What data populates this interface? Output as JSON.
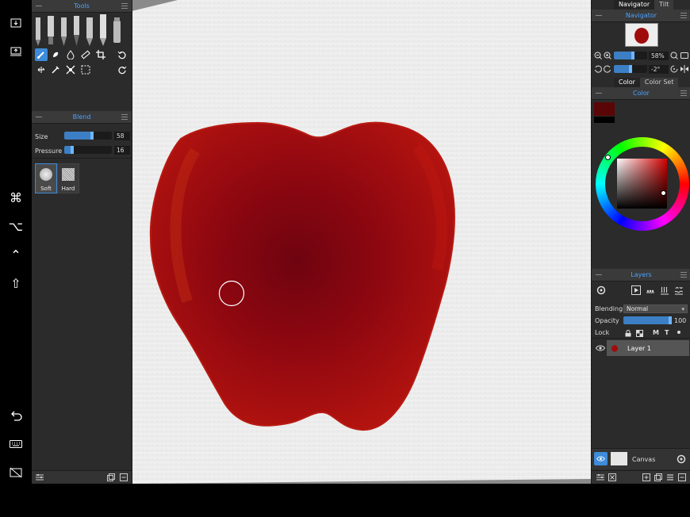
{
  "system_bar": {
    "icons": [
      "import-icon",
      "export-icon",
      "command-key-icon",
      "option-key-icon",
      "control-key-icon",
      "shift-key-icon",
      "undo-gesture-icon",
      "keyboard-icon",
      "hide-ui-icon"
    ]
  },
  "tools_panel": {
    "title": "Tools",
    "brushes": [
      "pencil",
      "brush-flat",
      "brush-round",
      "pen",
      "marker",
      "airbrush",
      "blender"
    ],
    "tool_icons": [
      "paint-brush-icon",
      "smudge-icon",
      "drop-fill-icon",
      "ruler-icon",
      "crop-icon",
      "rotate-left-icon",
      "pan-icon",
      "eyedropper-icon",
      "transform-icon",
      "selection-icon",
      "rotate-right-icon"
    ]
  },
  "blend_panel": {
    "title": "Blend",
    "size_label": "Size",
    "size_value": "58",
    "size_fraction": 0.58,
    "pressure_label": "Pressure",
    "pressure_value": "16",
    "pressure_fraction": 0.16,
    "presets": [
      {
        "name": "Soft",
        "selected": true
      },
      {
        "name": "Hard",
        "selected": false
      }
    ]
  },
  "navigator": {
    "tab_navigator": "Navigator",
    "tab_tilt": "Tilt",
    "title": "Navigator",
    "zoom_value": "58%",
    "zoom_fraction": 0.58,
    "rotation_value": "-2°",
    "rotation_fraction": 0.49
  },
  "color": {
    "tab_color": "Color",
    "tab_color_set": "Color Set",
    "title": "Color",
    "primary_color": "#5a0606",
    "secondary_color": "#000000",
    "hue_color": "#d40000"
  },
  "layers": {
    "title": "Layers",
    "blending_label": "Blending",
    "blending_value": "Normal",
    "opacity_label": "Opacity",
    "opacity_value": "100",
    "opacity_fraction": 1.0,
    "lock_label": "Lock",
    "lock_options": [
      "M",
      "T"
    ],
    "layer_list": [
      {
        "name": "Layer 1",
        "visible": true,
        "selected": true
      }
    ],
    "canvas_label": "Canvas"
  },
  "painting": {
    "subject": "red apple",
    "apple_color": "#a80c0c"
  }
}
